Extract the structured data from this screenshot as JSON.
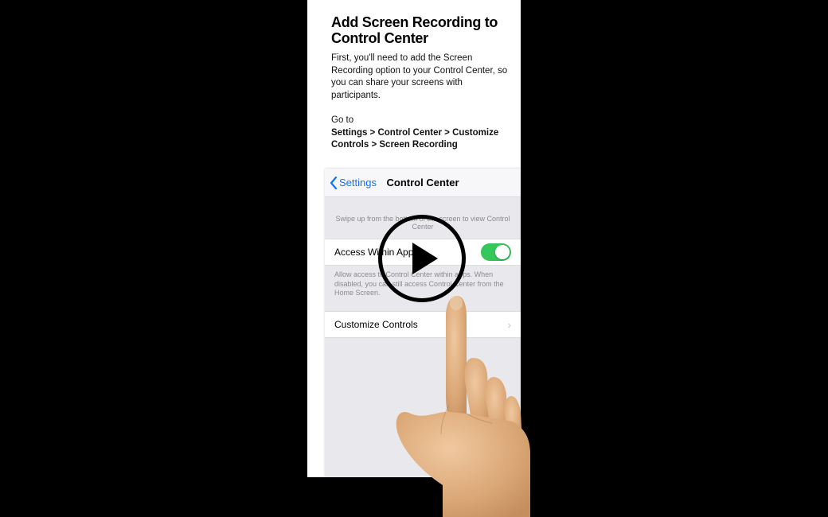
{
  "article": {
    "heading": "Add Screen Recording to Control Center",
    "description": "First, you'll need to add the Screen Recording option to your Control Center, so you can share your screens with participants.",
    "goto_label": "Go to",
    "path": "Settings > Control Center > Customize Controls > Screen Recording"
  },
  "phone": {
    "back_label": "Settings",
    "nav_title": "Control Center",
    "swipe_hint": "Swipe up from the bottom of the screen to view Control Center",
    "access_within_apps": {
      "label": "Access Within Apps",
      "enabled": true,
      "footer": "Allow access to Control Center within apps. When disabled, you can still access Control Center from the Home Screen."
    },
    "customize_controls_label": "Customize Controls"
  },
  "player": {
    "state": "paused"
  },
  "colors": {
    "ios_link": "#0b74ff",
    "ios_green": "#34c759",
    "ios_grey_bg": "#e9e9ed"
  }
}
